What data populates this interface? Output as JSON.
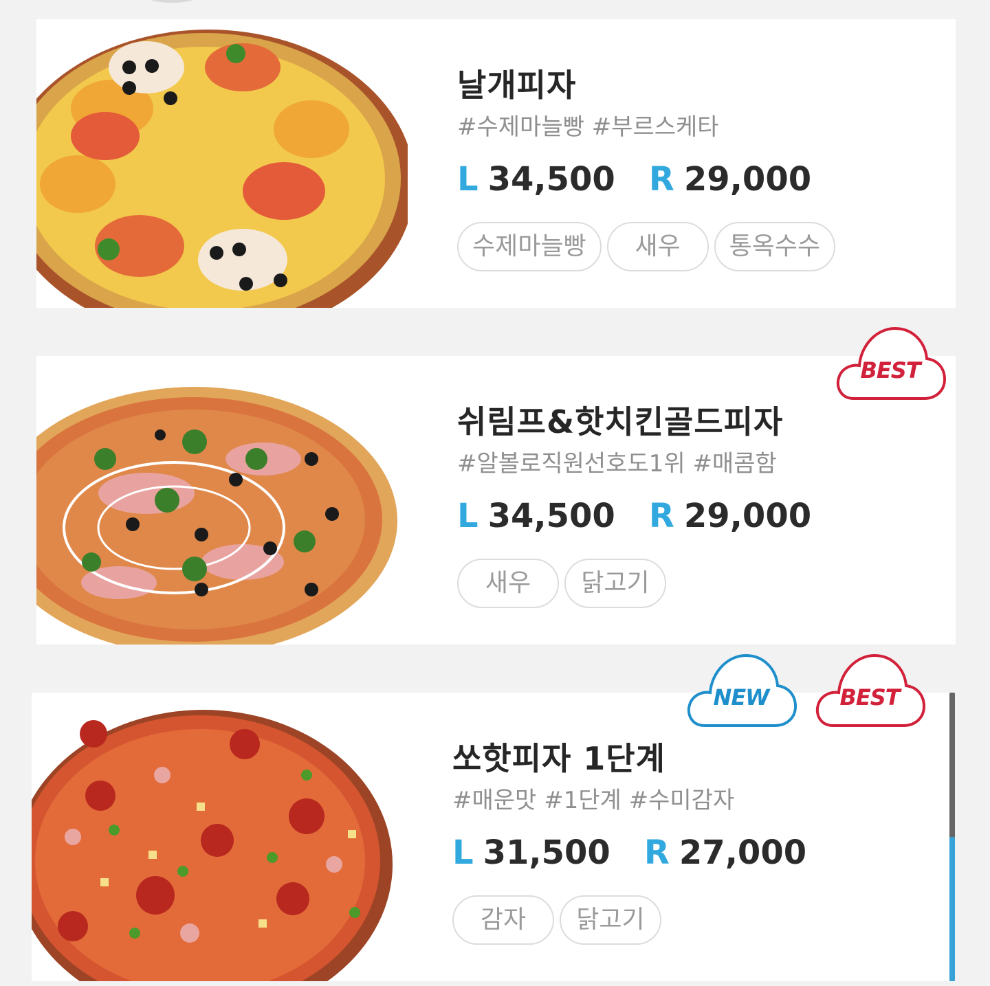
{
  "menu_items": [
    {
      "name": "날개피자",
      "hashtags": "#수제마늘빵 #부르스케타",
      "prices": [
        {
          "size": "L",
          "amount": "34,500"
        },
        {
          "size": "R",
          "amount": "29,000"
        }
      ],
      "ingredients": [
        "수제마늘빵",
        "새우",
        "통옥수수"
      ],
      "badges": []
    },
    {
      "name": "쉬림프&핫치킨골드피자",
      "hashtags": "#알볼로직원선호도1위 #매콤함",
      "prices": [
        {
          "size": "L",
          "amount": "34,500"
        },
        {
          "size": "R",
          "amount": "29,000"
        }
      ],
      "ingredients": [
        "새우",
        "닭고기"
      ],
      "badges": [
        "BEST"
      ]
    },
    {
      "name": "쏘핫피자 1단계",
      "hashtags": "#매운맛 #1단계 #수미감자",
      "prices": [
        {
          "size": "L",
          "amount": "31,500"
        },
        {
          "size": "R",
          "amount": "27,000"
        }
      ],
      "ingredients": [
        "감자",
        "닭고기"
      ],
      "badges": [
        "NEW",
        "BEST"
      ]
    }
  ],
  "colors": {
    "accent_size": "#31a9de",
    "best_badge": "#d2213a",
    "new_badge": "#1f8fcc",
    "background": "#f2f2f2"
  }
}
